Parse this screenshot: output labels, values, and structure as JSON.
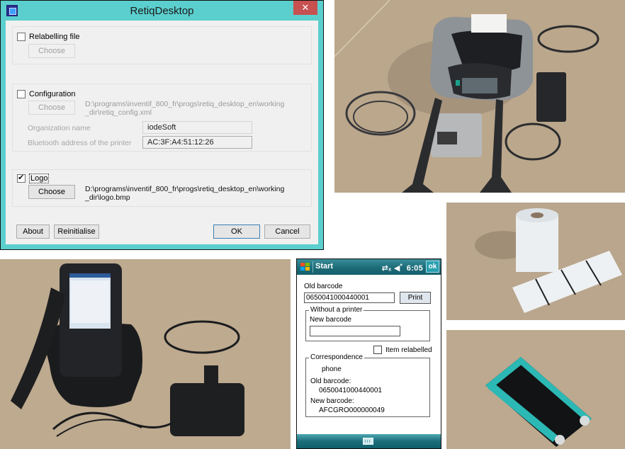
{
  "window": {
    "title": "RetiqDesktop",
    "close_icon": "close-icon",
    "app_icon": "app-grid-icon",
    "relabelling": {
      "checkbox_label": "Relabelling file",
      "checked": false,
      "choose_label": "Choose"
    },
    "configuration": {
      "checkbox_label": "Configuration",
      "checked": false,
      "choose_label": "Choose",
      "path_line1": "D:\\programs\\inventif_800_fr\\progs\\retiq_desktop_en\\working",
      "path_line2": "_dir\\retiq_config.xml",
      "org_label": "Organization name",
      "org_value": "iodeSoft",
      "bt_label": "Bluetooth address of the printer",
      "bt_value": "AC:3F:A4:51:12:26"
    },
    "logo": {
      "checkbox_label": "Logo",
      "checked": true,
      "choose_label": "Choose",
      "path_line1": "D:\\programs\\inventif_800_fr\\progs\\retiq_desktop_en\\working",
      "path_line2": "_dir\\logo.bmp"
    },
    "buttons": {
      "about": "About",
      "reinitialise": "Reinitialise",
      "ok": "OK",
      "cancel": "Cancel"
    }
  },
  "mobile": {
    "top_bar": {
      "start_label": "Start",
      "status": "⇄x ◀€ 6:05",
      "time": "6:05",
      "ok_label": "ok"
    },
    "old_barcode_label": "Old barcode",
    "old_barcode_value": "0650041000440001",
    "print_label": "Print",
    "without_printer": {
      "group_title": "Without a printer",
      "new_barcode_label": "New barcode",
      "new_barcode_value": ""
    },
    "item_relabelled_label": "Item relabelled",
    "item_relabelled_checked": false,
    "correspondence": {
      "group_title": "Correspondence",
      "item_name": "phone",
      "old_barcode_label": "Old barcode:",
      "old_barcode_value": "0650041000440001",
      "new_barcode_label": "New barcode:",
      "new_barcode_value": "AFCGRO000000049"
    }
  },
  "photos": {
    "printer": "Portable label printer with battery, straps and cables",
    "handheld": "Handheld terminal in charging dock with USB cable and power adapter",
    "label_roll": "Roll of blank labels",
    "ribbon": "Teal ribbon cartridge"
  }
}
